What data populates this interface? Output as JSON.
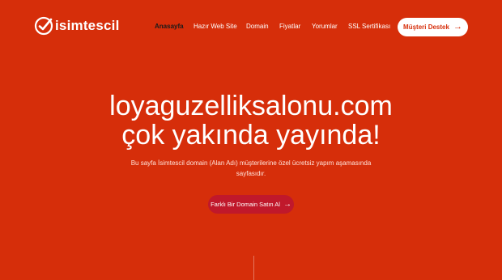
{
  "brand": {
    "name": "isimtescil"
  },
  "nav": {
    "items": [
      {
        "label": "Anasayfa"
      },
      {
        "label": "Hazır Web Site"
      },
      {
        "label": "Domain"
      },
      {
        "label": "Fiyatlar"
      },
      {
        "label": "Yorumlar"
      },
      {
        "label": "SSL Sertifikası"
      }
    ],
    "support_label": "Müşteri Destek",
    "support_arrow": "→"
  },
  "hero": {
    "title_line1": "loyaguzelliksalonu.com",
    "title_line2": "çok yakında yayında!",
    "description": "Bu sayfa İsimtescil domain (Alan Adı) müşterilerine özel ücretsiz yapım aşamasında sayfasıdır.",
    "cta_label": "Farklı Bir Domain Satın Al",
    "cta_arrow": "→"
  },
  "colors": {
    "background": "#d62e0a",
    "active_nav": "#1a1a1a",
    "cta_background": "#c0182b",
    "support_text": "#d62e0a"
  },
  "icons": {
    "logo": "checkmark-circle-icon",
    "support": "arrow-right-icon",
    "cta": "arrow-right-icon"
  }
}
